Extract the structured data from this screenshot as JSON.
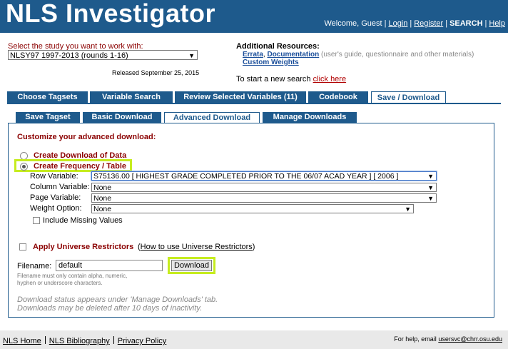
{
  "header": {
    "logo": "NLS Investigator",
    "welcome": "Welcome, Guest",
    "login": "Login",
    "register": "Register",
    "search": "SEARCH",
    "help": "Help"
  },
  "study": {
    "label": "Select the study you want to work with:",
    "selected": "NLSY97 1997-2013 (rounds 1-16)",
    "released": "Released September 25, 2015"
  },
  "resources": {
    "title": "Additional Resources:",
    "errata": "Errata",
    "documentation": "Documentation",
    "doc_note": "(user's guide, questionnaire and other materials)",
    "custom_weights": "Custom Weights",
    "new_search_prefix": "To start a new search",
    "new_search_link": "click here"
  },
  "main_tabs": [
    {
      "label": "Choose Tagsets"
    },
    {
      "label": "Variable Search"
    },
    {
      "label": "Review Selected Variables (11)"
    },
    {
      "label": "Codebook"
    },
    {
      "label": "Save / Download"
    }
  ],
  "sub_tabs": [
    {
      "label": "Save Tagset"
    },
    {
      "label": "Basic Download"
    },
    {
      "label": "Advanced Download"
    },
    {
      "label": "Manage Downloads"
    }
  ],
  "advanced": {
    "heading": "Customize your advanced download:",
    "option_data": "Create Download of Data",
    "option_freq": "Create Frequency / Table",
    "row_label": "Row Variable:",
    "row_value": "S75136.00 [ HIGHEST GRADE COMPLETED PRIOR TO THE 06/07 ACAD YEAR ] [ 2006 ]",
    "col_label": "Column Variable:",
    "col_value": "None",
    "page_label": "Page Variable:",
    "page_value": "None",
    "weight_label": "Weight Option:",
    "weight_value": "None",
    "include_missing": "Include Missing Values",
    "universe_label": "Apply Universe Restrictors",
    "universe_link": "How to use Universe Restrictors",
    "filename_label": "Filename:",
    "filename_value": "default",
    "download_button": "Download",
    "filename_help": "Filename must only contain alpha, numeric, hyphen or underscore characters.",
    "status_line1": "Download status appears under 'Manage Downloads' tab.",
    "status_line2": "Downloads may be deleted after 10 days of inactivity."
  },
  "footer": {
    "home": "NLS Home",
    "bibliography": "NLS Bibliography",
    "privacy": "Privacy Policy",
    "help_prefix": "For help, email",
    "help_email": "usersvc@chrr.osu.edu"
  },
  "colors": {
    "brand_blue": "#1e5a8c",
    "label_red": "#8b0000",
    "highlight": "#c6ec1f"
  }
}
